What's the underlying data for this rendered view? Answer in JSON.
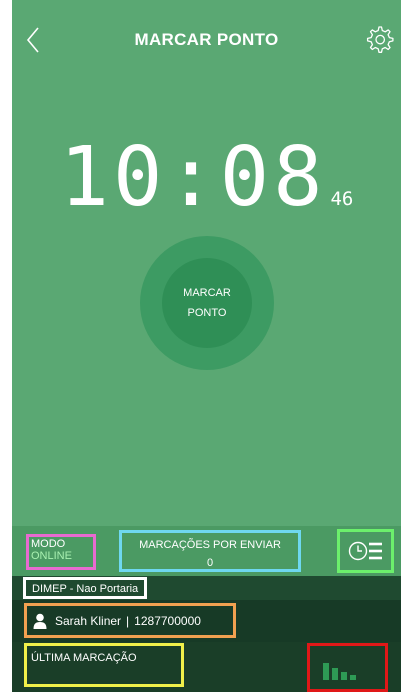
{
  "header": {
    "title": "MARCAR PONTO",
    "back_icon": "chevron-left-icon",
    "settings_icon": "gear-icon"
  },
  "clock": {
    "hours_minutes": "10:08",
    "seconds": "46"
  },
  "punch_button": {
    "line1": "MARCAR",
    "line2": "PONTO"
  },
  "status_bar": {
    "mode_label": "MODO",
    "mode_value": "ONLINE",
    "pending_label": "MARCAÇÕES POR ENVIAR",
    "pending_count": "0",
    "history_icon": "clock-list-icon"
  },
  "device": {
    "name": "DIMEP - Nao Portaria"
  },
  "user": {
    "name": "Sarah Kliner",
    "separator": "|",
    "id": "1287700000",
    "icon": "person-icon"
  },
  "last_punch": {
    "label": "ÚLTIMA MARCAÇÃO",
    "signal_icon": "signal-bars-icon"
  },
  "colors": {
    "background": "#5aa873",
    "button_outer": "#3d9b63",
    "button_inner": "#2f8f56",
    "dark_row": "#173a26",
    "mode_value": "#a8f0b0"
  }
}
